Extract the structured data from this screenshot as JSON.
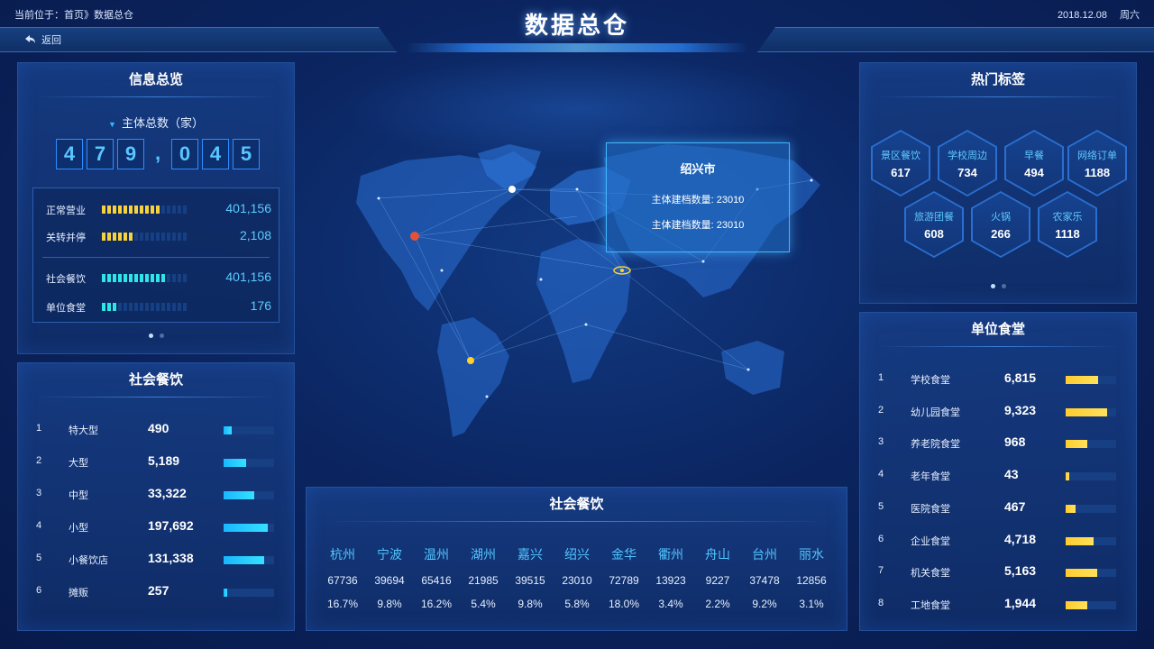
{
  "header": {
    "breadcrumb": "当前位于：首页》数据总仓",
    "title": "数据总仓",
    "date": "2018.12.08",
    "weekday": "周六",
    "back_label": "返回"
  },
  "overview": {
    "title": "信息总览",
    "total_label": "主体总数（家）",
    "digits": [
      "4",
      "7",
      "9",
      ",",
      "0",
      "4",
      "5"
    ],
    "stats": [
      {
        "label": "正常营业",
        "value": "401,156",
        "fill": 0.7,
        "color": "#f7d23a"
      },
      {
        "label": "关转并停",
        "value": "2,108",
        "fill": 0.35,
        "color": "#f7d23a"
      },
      {
        "label": "社会餐饮",
        "value": "401,156",
        "fill": 0.78,
        "color": "#2ee6e6"
      },
      {
        "label": "单位食堂",
        "value": "176",
        "fill": 0.17,
        "color": "#2ee6e6"
      }
    ]
  },
  "social_dining": {
    "title": "社会餐饮",
    "rows": [
      {
        "idx": "1",
        "name": "特大型",
        "value": "490",
        "fill": 0.16
      },
      {
        "idx": "2",
        "name": "大型",
        "value": "5,189",
        "fill": 0.44
      },
      {
        "idx": "3",
        "name": "中型",
        "value": "33,322",
        "fill": 0.6
      },
      {
        "idx": "4",
        "name": "小型",
        "value": "197,692",
        "fill": 0.88
      },
      {
        "idx": "5",
        "name": "小餐饮店",
        "value": "131,338",
        "fill": 0.8
      },
      {
        "idx": "6",
        "name": "摊贩",
        "value": "257",
        "fill": 0.08
      }
    ]
  },
  "hot_tags": {
    "title": "热门标签",
    "tags": [
      {
        "name": "景区餐饮",
        "value": "617"
      },
      {
        "name": "学校周边",
        "value": "734"
      },
      {
        "name": "早餐",
        "value": "494"
      },
      {
        "name": "网络订单",
        "value": "1188"
      },
      {
        "name": "旅游团餐",
        "value": "608"
      },
      {
        "name": "火锅",
        "value": "266"
      },
      {
        "name": "农家乐",
        "value": "1118"
      }
    ]
  },
  "canteens": {
    "title": "单位食堂",
    "rows": [
      {
        "idx": "1",
        "name": "学校食堂",
        "value": "6,815",
        "fill": 0.65
      },
      {
        "idx": "2",
        "name": "幼儿园食堂",
        "value": "9,323",
        "fill": 0.82
      },
      {
        "idx": "3",
        "name": "养老院食堂",
        "value": "968",
        "fill": 0.43
      },
      {
        "idx": "4",
        "name": "老年食堂",
        "value": "43",
        "fill": 0.07
      },
      {
        "idx": "5",
        "name": "医院食堂",
        "value": "467",
        "fill": 0.2
      },
      {
        "idx": "6",
        "name": "企业食堂",
        "value": "4,718",
        "fill": 0.55
      },
      {
        "idx": "7",
        "name": "机关食堂",
        "value": "5,163",
        "fill": 0.63
      },
      {
        "idx": "8",
        "name": "工地食堂",
        "value": "1,944",
        "fill": 0.43
      }
    ]
  },
  "map": {
    "tooltip_title": "绍兴市",
    "tooltip_lines": [
      "主体建档数量: 23010",
      "主体建档数量: 23010"
    ]
  },
  "city_table": {
    "title": "社会餐饮",
    "cities": [
      "杭州",
      "宁波",
      "温州",
      "湖州",
      "嘉兴",
      "绍兴",
      "金华",
      "衢州",
      "舟山",
      "台州",
      "丽水"
    ],
    "counts": [
      "67736",
      "39694",
      "65416",
      "21985",
      "39515",
      "23010",
      "72789",
      "13923",
      "9227",
      "37478",
      "12856"
    ],
    "pcts": [
      "16.7%",
      "9.8%",
      "16.2%",
      "5.4%",
      "9.8%",
      "5.8%",
      "18.0%",
      "3.4%",
      "2.2%",
      "9.2%",
      "3.1%"
    ]
  }
}
